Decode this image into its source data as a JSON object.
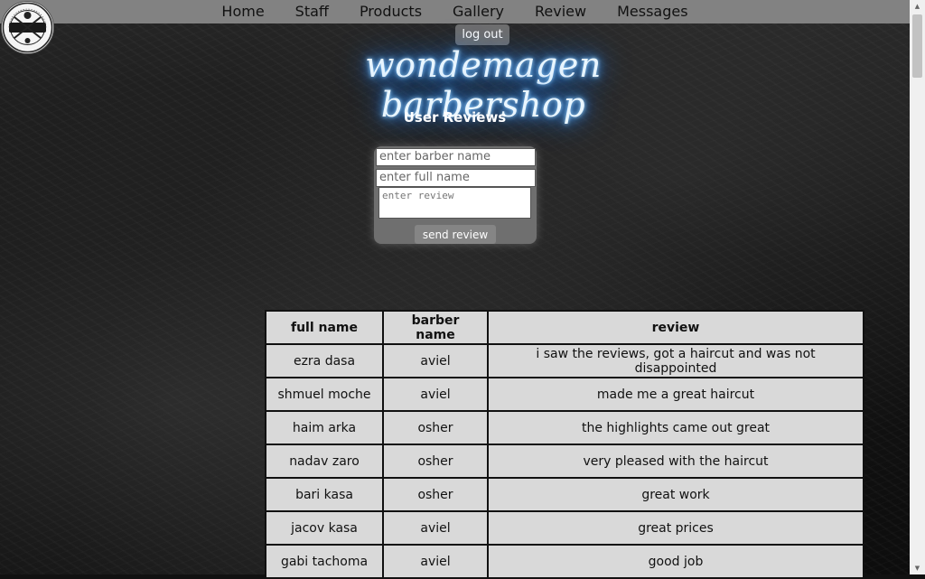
{
  "nav": {
    "items": [
      {
        "label": "Home"
      },
      {
        "label": "Staff"
      },
      {
        "label": "Products"
      },
      {
        "label": "Gallery"
      },
      {
        "label": "Review"
      },
      {
        "label": "Messages"
      }
    ]
  },
  "header": {
    "logout_label": "log out",
    "title": "wondemagen barbershop",
    "subtitle": "User Reviews",
    "logo": {
      "top_text": "GENTLEMEN'S",
      "main_text": "WONDEMAGEN",
      "bottom_text": "BARBERSHOP"
    }
  },
  "form": {
    "barber_placeholder": "enter barber name",
    "fullname_placeholder": "enter full name",
    "review_placeholder": "enter review",
    "send_label": "send review"
  },
  "table": {
    "headers": [
      "full name",
      "barber name",
      "review"
    ],
    "rows": [
      [
        "ezra dasa",
        "aviel",
        "i saw the reviews, got a haircut and was not disappointed"
      ],
      [
        "shmuel moche",
        "aviel",
        "made me a great haircut"
      ],
      [
        "haim arka",
        "osher",
        "the highlights came out great"
      ],
      [
        "nadav zaro",
        "osher",
        "very pleased with the haircut"
      ],
      [
        "bari kasa",
        "osher",
        "great work"
      ],
      [
        "jacov kasa",
        "aviel",
        "great prices"
      ],
      [
        "gabi tachoma",
        "aviel",
        "good job"
      ]
    ]
  },
  "colors": {
    "navbar": "#828282",
    "neon": "#4aa8ff",
    "table_cell": "#d9d9d9"
  }
}
